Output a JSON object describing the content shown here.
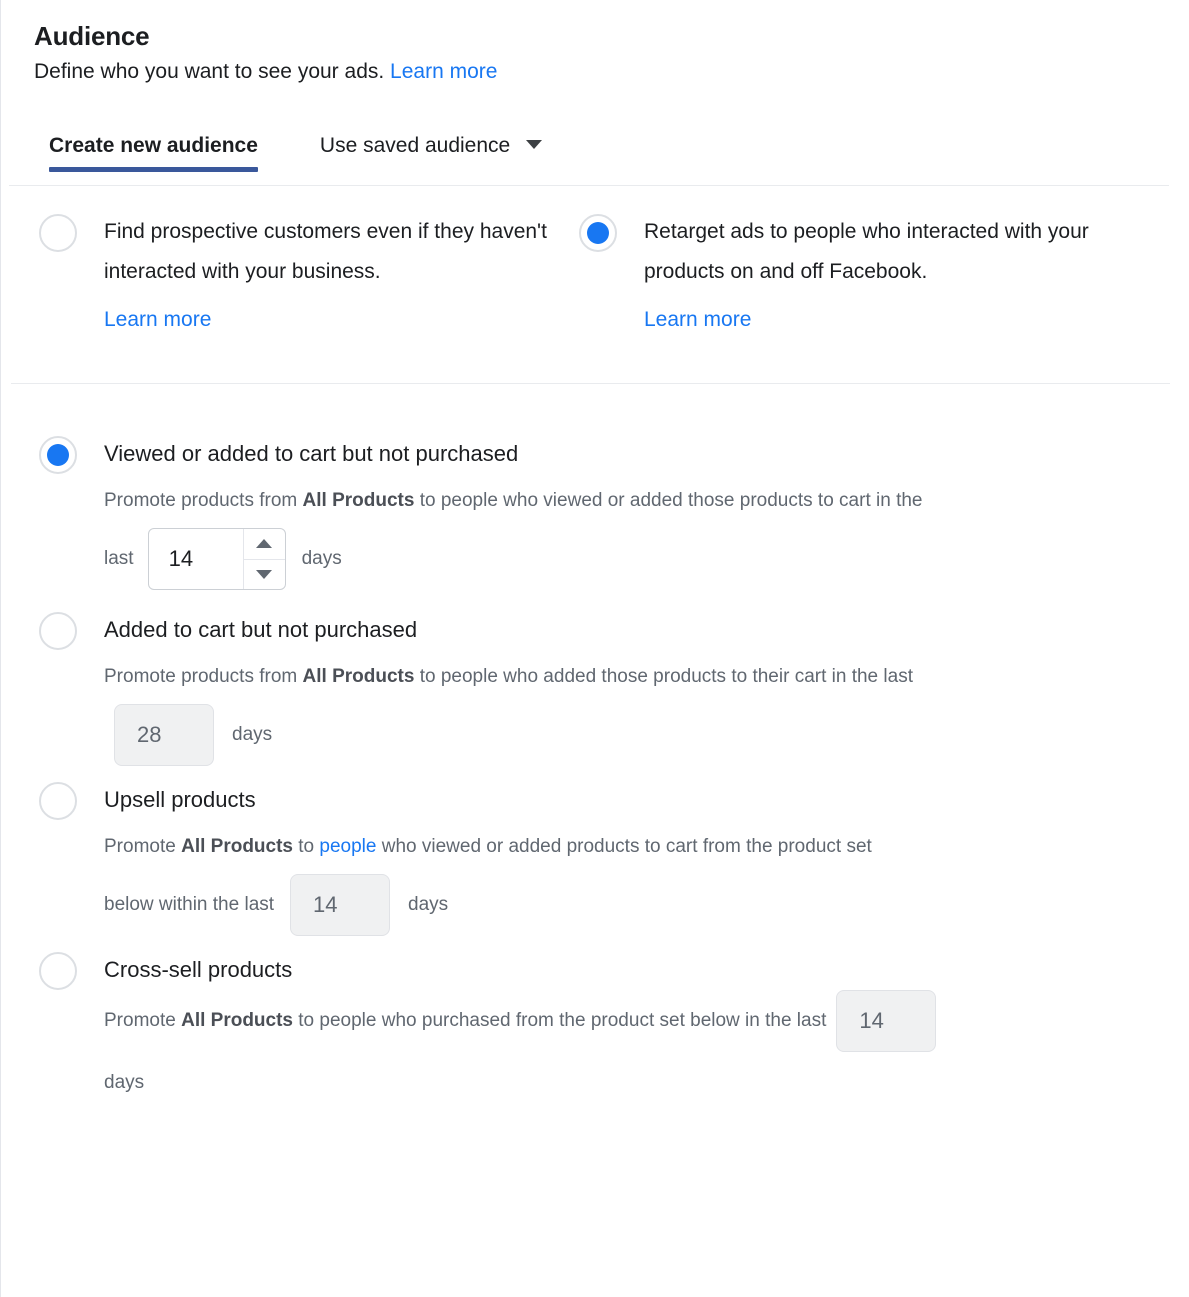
{
  "header": {
    "title": "Audience",
    "subtitle": "Define who you want to see your ads.",
    "learn_more": "Learn more"
  },
  "tabs": [
    {
      "label": "Create new audience",
      "active": true
    },
    {
      "label": "Use saved audience",
      "active": false,
      "has_caret": true
    }
  ],
  "audience_mode": {
    "selected": "retarget",
    "options": [
      {
        "id": "prospecting",
        "text": "Find prospective customers even if they haven't interacted with your business.",
        "learn_more": "Learn more",
        "selected": false
      },
      {
        "id": "retarget",
        "text": "Retarget ads to people who interacted with your products on and off Facebook.",
        "learn_more": "Learn more",
        "selected": true
      }
    ]
  },
  "retargeting": {
    "selected": "viewed_or_added",
    "options": [
      {
        "id": "viewed_or_added",
        "title": "Viewed or added to cart but not purchased",
        "selected": true,
        "desc_part1": "Promote products from ",
        "desc_bold": "All Products",
        "desc_part2": " to people who viewed or added those products to cart in the",
        "field_prefix": "last",
        "field_value": "14",
        "field_suffix": "days",
        "field_type": "spinner",
        "field_enabled": true
      },
      {
        "id": "added_to_cart",
        "title": "Added to cart but not purchased",
        "selected": false,
        "desc_part1": "Promote products from ",
        "desc_bold": "All Products",
        "desc_part2": " to people who added those products to their cart in the last",
        "field_prefix": "",
        "field_value": "28",
        "field_suffix": "days",
        "field_type": "numbox",
        "field_enabled": false
      },
      {
        "id": "upsell",
        "title": "Upsell products",
        "selected": false,
        "desc_part1": "Promote ",
        "desc_bold": "All Products",
        "desc_part2": " to ",
        "desc_link": "people",
        "desc_part3": " who viewed or added products to cart from the product set",
        "field_prefix": "below within the last",
        "field_value": "14",
        "field_suffix": "days",
        "field_type": "numbox",
        "field_enabled": false
      },
      {
        "id": "cross_sell",
        "title": "Cross-sell products",
        "selected": false,
        "desc_part1": "Promote ",
        "desc_bold": "All Products",
        "desc_part2": " to people who purchased from the product set below in the last",
        "field_value": "14",
        "field_suffix": "days",
        "field_type": "numbox",
        "field_enabled": false
      }
    ]
  },
  "colors": {
    "link": "#1877f2",
    "radio_selected": "#1877f2",
    "tab_active_underline": "#3a589b",
    "text_primary": "#1c1e21",
    "text_secondary": "#606770",
    "disabled_field_bg": "#f0f1f2"
  }
}
